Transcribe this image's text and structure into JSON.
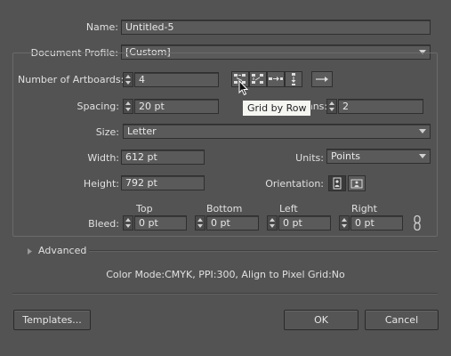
{
  "name": {
    "label": "Name:",
    "value": "Untitled-5"
  },
  "profile": {
    "label": "Document Profile:",
    "value": "[Custom]"
  },
  "artboards": {
    "count_label": "Number of Artboards:",
    "count_value": "4",
    "spacing_label": "Spacing:",
    "spacing_value": "20 pt",
    "columns_label": "mns:",
    "columns_value": "2",
    "tooltip": "Grid by Row",
    "layout_icons": [
      "grid-by-row-icon",
      "grid-by-column-icon",
      "arrange-by-row-icon",
      "arrange-by-column-icon",
      "change-to-right-to-left-icon"
    ]
  },
  "size": {
    "label": "Size:",
    "value": "Letter"
  },
  "width": {
    "label": "Width:",
    "value": "612 pt"
  },
  "height": {
    "label": "Height:",
    "value": "792 pt"
  },
  "units": {
    "label": "Units:",
    "value": "Points"
  },
  "orientation": {
    "label": "Orientation:"
  },
  "bleed": {
    "label": "Bleed:",
    "top_label": "Top",
    "top_value": "0 pt",
    "bottom_label": "Bottom",
    "bottom_value": "0 pt",
    "left_label": "Left",
    "left_value": "0 pt",
    "right_label": "Right",
    "right_value": "0 pt"
  },
  "advanced": {
    "label": "Advanced"
  },
  "summary": "Color Mode:CMYK, PPI:300, Align to Pixel Grid:No",
  "buttons": {
    "templates": "Templates...",
    "ok": "OK",
    "cancel": "Cancel"
  },
  "colors": {
    "background": "#535353",
    "field": "#444444",
    "text": "#e0e0e0"
  }
}
